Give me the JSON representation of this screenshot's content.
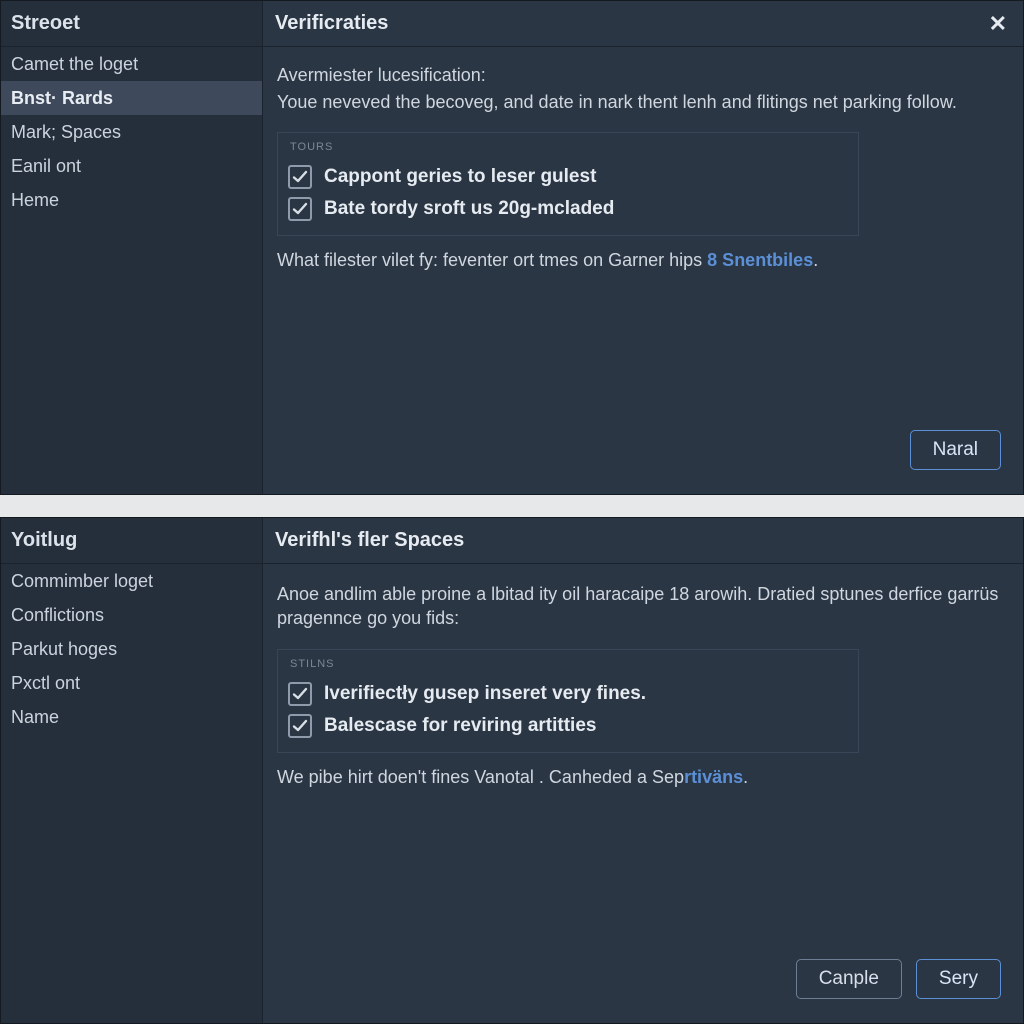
{
  "colors": {
    "accent": "#5b8fd6",
    "bg": "#2b3644"
  },
  "panel1": {
    "sidebar": {
      "title": "Streoet",
      "items": [
        {
          "label": "Camet the loget",
          "selected": false
        },
        {
          "label": "Bnst· Rards",
          "selected": true
        },
        {
          "label": "Mark; Spaces",
          "selected": false
        },
        {
          "label": "Eanil ont",
          "selected": false
        },
        {
          "label": "Heme",
          "selected": false
        }
      ]
    },
    "title": "Verificraties",
    "intro_heading": "Avermiester lucesification:",
    "intro_body": "Youe neveved the becoveg, and date in nark thent lenh and flitings net parking follow.",
    "options_caption": "Tours",
    "options": [
      {
        "label": "Cappont geries to leser gulest",
        "checked": true
      },
      {
        "label": "Bate tordy sroft us 20g-mcladed",
        "checked": true
      }
    ],
    "hint_prefix": "What filester vilet fy: feventer ort tmes on Garner hips ",
    "hint_link": "8 Snentbiles",
    "hint_suffix": ".",
    "primary_label": "Naral"
  },
  "panel2": {
    "sidebar": {
      "title": "Yoitlug",
      "items": [
        {
          "label": "Commimber loget",
          "selected": false
        },
        {
          "label": "Conflictions",
          "selected": false
        },
        {
          "label": "Parkut hoges",
          "selected": false
        },
        {
          "label": "Pxctl ont",
          "selected": false
        },
        {
          "label": "Name",
          "selected": false
        }
      ]
    },
    "title": "Verifhl's fler Spaces",
    "intro_body": "Anoe andlim able proine a lbitad ity oil haracaipe 18 arowih. Dratied sptunes derfice garrüs pragennce go you fids:",
    "options_caption": "Stilns",
    "options": [
      {
        "label": "Iverifiectły gusep inseret very fines.",
        "checked": true
      },
      {
        "label": "Balescase for reviring artitties",
        "checked": true
      }
    ],
    "hint_prefix": "We pibe hirt doen't fines Vanotal . Canheded a Sep",
    "hint_link": "rtiväns",
    "hint_suffix": ".",
    "cancel_label": "Canple",
    "primary_label": "Sery"
  }
}
